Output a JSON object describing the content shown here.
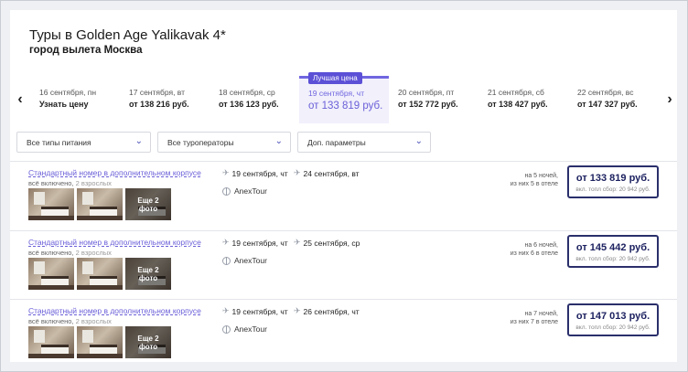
{
  "header": {
    "title": "Туры в Golden Age Yalikavak 4*",
    "subtitle": "город вылета Москва"
  },
  "calendar": {
    "best_badge": "Лучшая цена",
    "dates": [
      {
        "label": "16 сентября, пн",
        "price": "Узнать цену"
      },
      {
        "label": "17 сентября, вт",
        "price": "от 138 216 руб."
      },
      {
        "label": "18 сентября, ср",
        "price": "от 136 123 руб."
      },
      {
        "label": "19 сентября, чт",
        "price": "от 133 819 руб."
      },
      {
        "label": "20 сентября, пт",
        "price": "от 152 772 руб."
      },
      {
        "label": "21 сентября, сб",
        "price": "от 138 427 руб."
      },
      {
        "label": "22 сентября, вс",
        "price": "от 147 327 руб."
      }
    ],
    "active_index": 3,
    "prev_icon": "chevron-left-icon",
    "next_icon": "chevron-right-icon"
  },
  "filters": {
    "meal": "Все типы питания",
    "operators": "Все туроператоры",
    "extra": "Доп. параметры"
  },
  "offers": [
    {
      "room": "Стандартный номер в дополнительном корпусе",
      "meal": "всё включено,",
      "adults": "2 взрослых",
      "more_photos": "Еще 2 фото",
      "depart": "19 сентября, чт",
      "return": "24 сентября, вт",
      "operator": "AnexTour",
      "nights_line1": "на 5 ночей,",
      "nights_line2": "из них 5 в отеле",
      "price": "от 133 819 руб.",
      "fee": "вкл. топл сбор: 20 942 руб."
    },
    {
      "room": "Стандартный номер в дополнительном корпусе",
      "meal": "всё включено,",
      "adults": "2 взрослых",
      "more_photos": "Еще 2 фото",
      "depart": "19 сентября, чт",
      "return": "25 сентября, ср",
      "operator": "AnexTour",
      "nights_line1": "на 6 ночей,",
      "nights_line2": "из них 6 в отеле",
      "price": "от 145 442 руб.",
      "fee": "вкл. топл сбор: 20 942 руб."
    },
    {
      "room": "Стандартный номер в дополнительном корпусе",
      "meal": "всё включено,",
      "adults": "2 взрослых",
      "more_photos": "Еще 2 фото",
      "depart": "19 сентября, чт",
      "return": "26 сентября, чт",
      "operator": "AnexTour",
      "nights_line1": "на 7 ночей,",
      "nights_line2": "из них 7 в отеле",
      "price": "от 147 013 руб.",
      "fee": "вкл. топл сбор: 20 942 руб."
    }
  ],
  "colors": {
    "accent": "#6a5fd8",
    "badge": "#5b50d6",
    "price_border": "#2a2f6b"
  }
}
